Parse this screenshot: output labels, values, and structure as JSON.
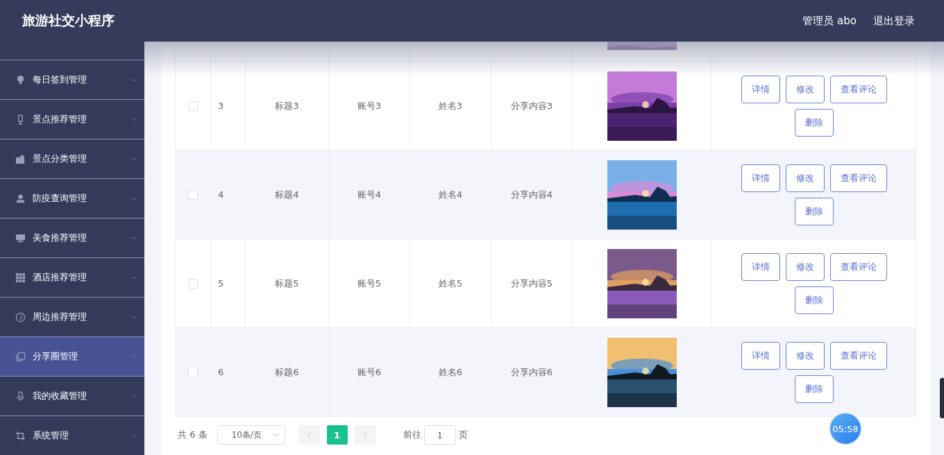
{
  "header": {
    "title": "旅游社交小程序",
    "user": "管理员 abo",
    "logout": "退出登录"
  },
  "sidebar": {
    "items": [
      {
        "label": "每日签到管理",
        "selected": false
      },
      {
        "label": "景点推荐管理",
        "selected": false
      },
      {
        "label": "景点分类管理",
        "selected": false
      },
      {
        "label": "防疫查询管理",
        "selected": false
      },
      {
        "label": "美食推荐管理",
        "selected": false
      },
      {
        "label": "酒店推荐管理",
        "selected": false
      },
      {
        "label": "周边推荐管理",
        "selected": false
      },
      {
        "label": "分享圈管理",
        "selected": true
      },
      {
        "label": "我的收藏管理",
        "selected": false
      },
      {
        "label": "系统管理",
        "selected": false
      }
    ]
  },
  "table": {
    "rows": [
      {
        "checked": false,
        "index": "3",
        "title": "标题3",
        "account": "账号3",
        "name": "姓名3",
        "content": "分享内容3",
        "actions": [
          "详情",
          "修改",
          "查看评论",
          "删除"
        ]
      },
      {
        "checked": false,
        "index": "4",
        "title": "标题4",
        "account": "账号4",
        "name": "姓名4",
        "content": "分享内容4",
        "actions": [
          "详情",
          "修改",
          "查看评论",
          "删除"
        ]
      },
      {
        "checked": false,
        "index": "5",
        "title": "标题5",
        "account": "账号5",
        "name": "姓名5",
        "content": "分享内容5",
        "actions": [
          "详情",
          "修改",
          "查看评论",
          "删除"
        ]
      },
      {
        "checked": false,
        "index": "6",
        "title": "标题6",
        "account": "账号6",
        "name": "姓名6",
        "content": "分享内容6",
        "actions": [
          "详情",
          "修改",
          "查看评论",
          "删除"
        ]
      }
    ]
  },
  "pagination": {
    "total": "共 6 条",
    "page_size": "10条/页",
    "pages": [
      {
        "label": "1",
        "selected": true
      }
    ],
    "goto_label": "前往",
    "goto_value": "1",
    "goto_suffix": "页"
  },
  "timer": "05:58"
}
